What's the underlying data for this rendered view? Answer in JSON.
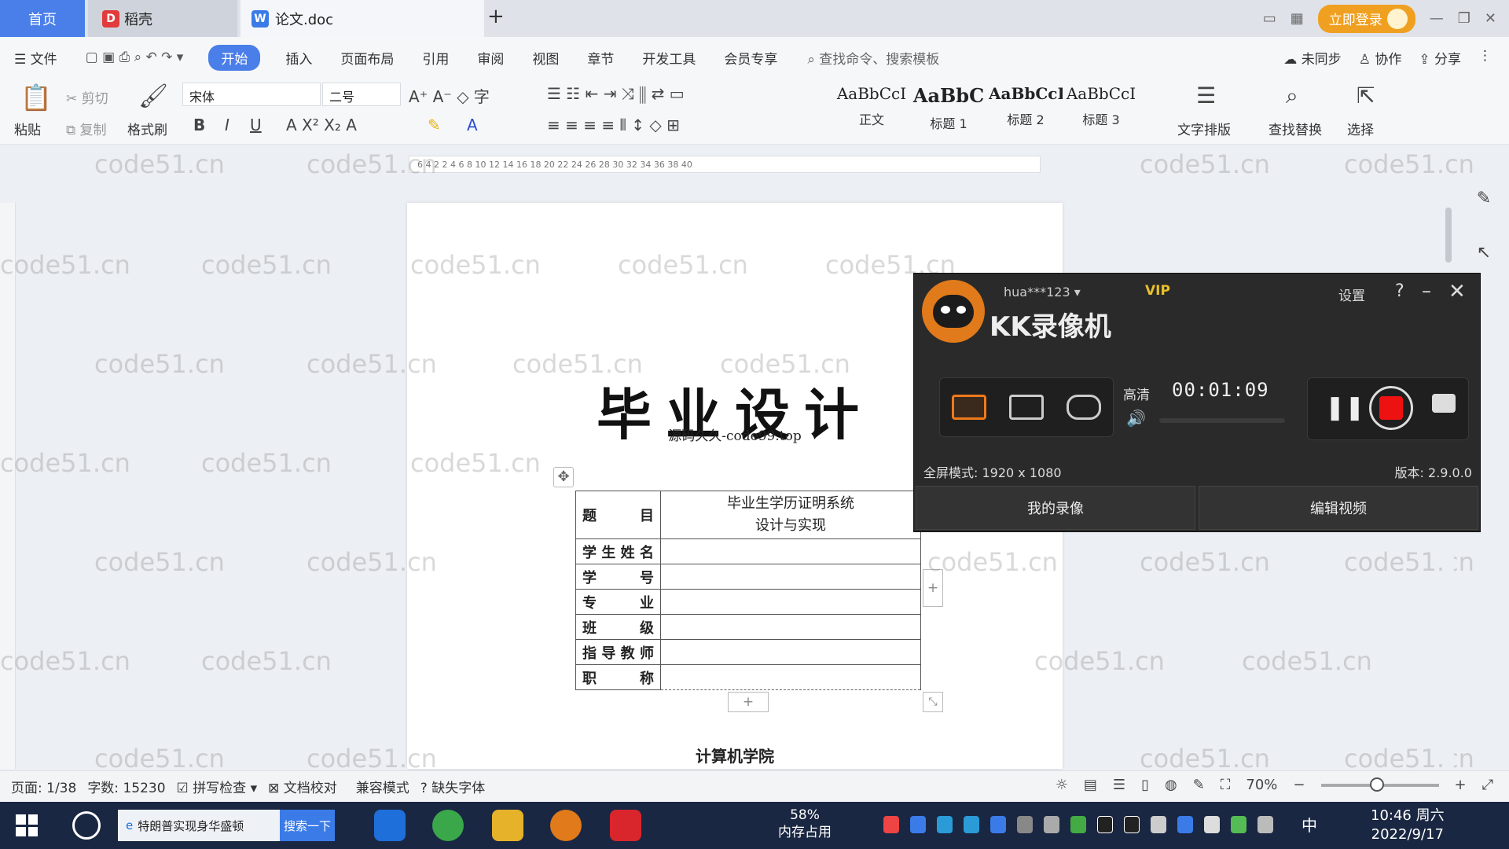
{
  "tabs": {
    "home": "首页",
    "docer": "稻壳",
    "doc": "论文.doc",
    "add": "+"
  },
  "window": {
    "login": "立即登录"
  },
  "menu": {
    "file": "文件",
    "items": [
      "开始",
      "插入",
      "页面布局",
      "引用",
      "审阅",
      "视图",
      "章节",
      "开发工具",
      "会员专享"
    ],
    "search_cmd": "查找命令、搜索模板",
    "sync": "未同步",
    "collab": "协作",
    "share": "分享"
  },
  "ribbon": {
    "paste": "粘贴",
    "cut": "剪切",
    "copy": "复制",
    "format_painter": "格式刷",
    "font_name": "宋体",
    "font_size": "二号",
    "styles": [
      {
        "sample": "AaBbCcI",
        "label": "正文"
      },
      {
        "sample": "AaBbC",
        "label": "标题 1"
      },
      {
        "sample": "AaBbCcI",
        "label": "标题 2"
      },
      {
        "sample": "AaBbCcI",
        "label": "标题 3"
      }
    ],
    "text_layout": "文字排版",
    "find_replace": "查找替换",
    "select": "选择"
  },
  "ruler_ticks": "6 4 2 2 4 6 8 10 12 14 16 18 20 22 24 26 28 30 32 34 36 38 40",
  "document": {
    "title": "毕业设计",
    "subtitle": "源码久久-code99.top",
    "table": [
      {
        "key": "题    目",
        "value": "毕业生学历证明系统\n设计与实现"
      },
      {
        "key": "学生姓名",
        "value": ""
      },
      {
        "key": "学    号",
        "value": ""
      },
      {
        "key": "专    业",
        "value": ""
      },
      {
        "key": "班    级",
        "value": ""
      },
      {
        "key": "指导教师",
        "value": ""
      },
      {
        "key": "职    称",
        "value": ""
      }
    ],
    "college": "计算机学院"
  },
  "watermark": "code51.cn",
  "kk": {
    "user": "hua***123",
    "vip": "VIP",
    "name": "KK录像机",
    "settings": "设置",
    "help": "?",
    "quality": "高清",
    "timer": "00:01:09",
    "fullscreen": "全屏模式: 1920 x 1080",
    "version": "版本: 2.9.0.0",
    "my_videos": "我的录像",
    "edit_video": "编辑视频"
  },
  "status": {
    "page": "页面: 1/38",
    "words": "字数: 15230",
    "spell": "拼写检查",
    "proof": "文档校对",
    "compat": "兼容模式",
    "missing_font": "缺失字体",
    "zoom": "70%"
  },
  "taskbar": {
    "search_text": "特朗普实现身华盛顿",
    "search_btn": "搜索一下",
    "mem_percent": "58%",
    "mem_label": "内存占用",
    "ime": "中",
    "time": "10:46 周六",
    "date": "2022/9/17"
  },
  "colors": {
    "accent": "#4a7ee8",
    "kk_orange": "#f07a1a",
    "record_red": "#e11111"
  }
}
